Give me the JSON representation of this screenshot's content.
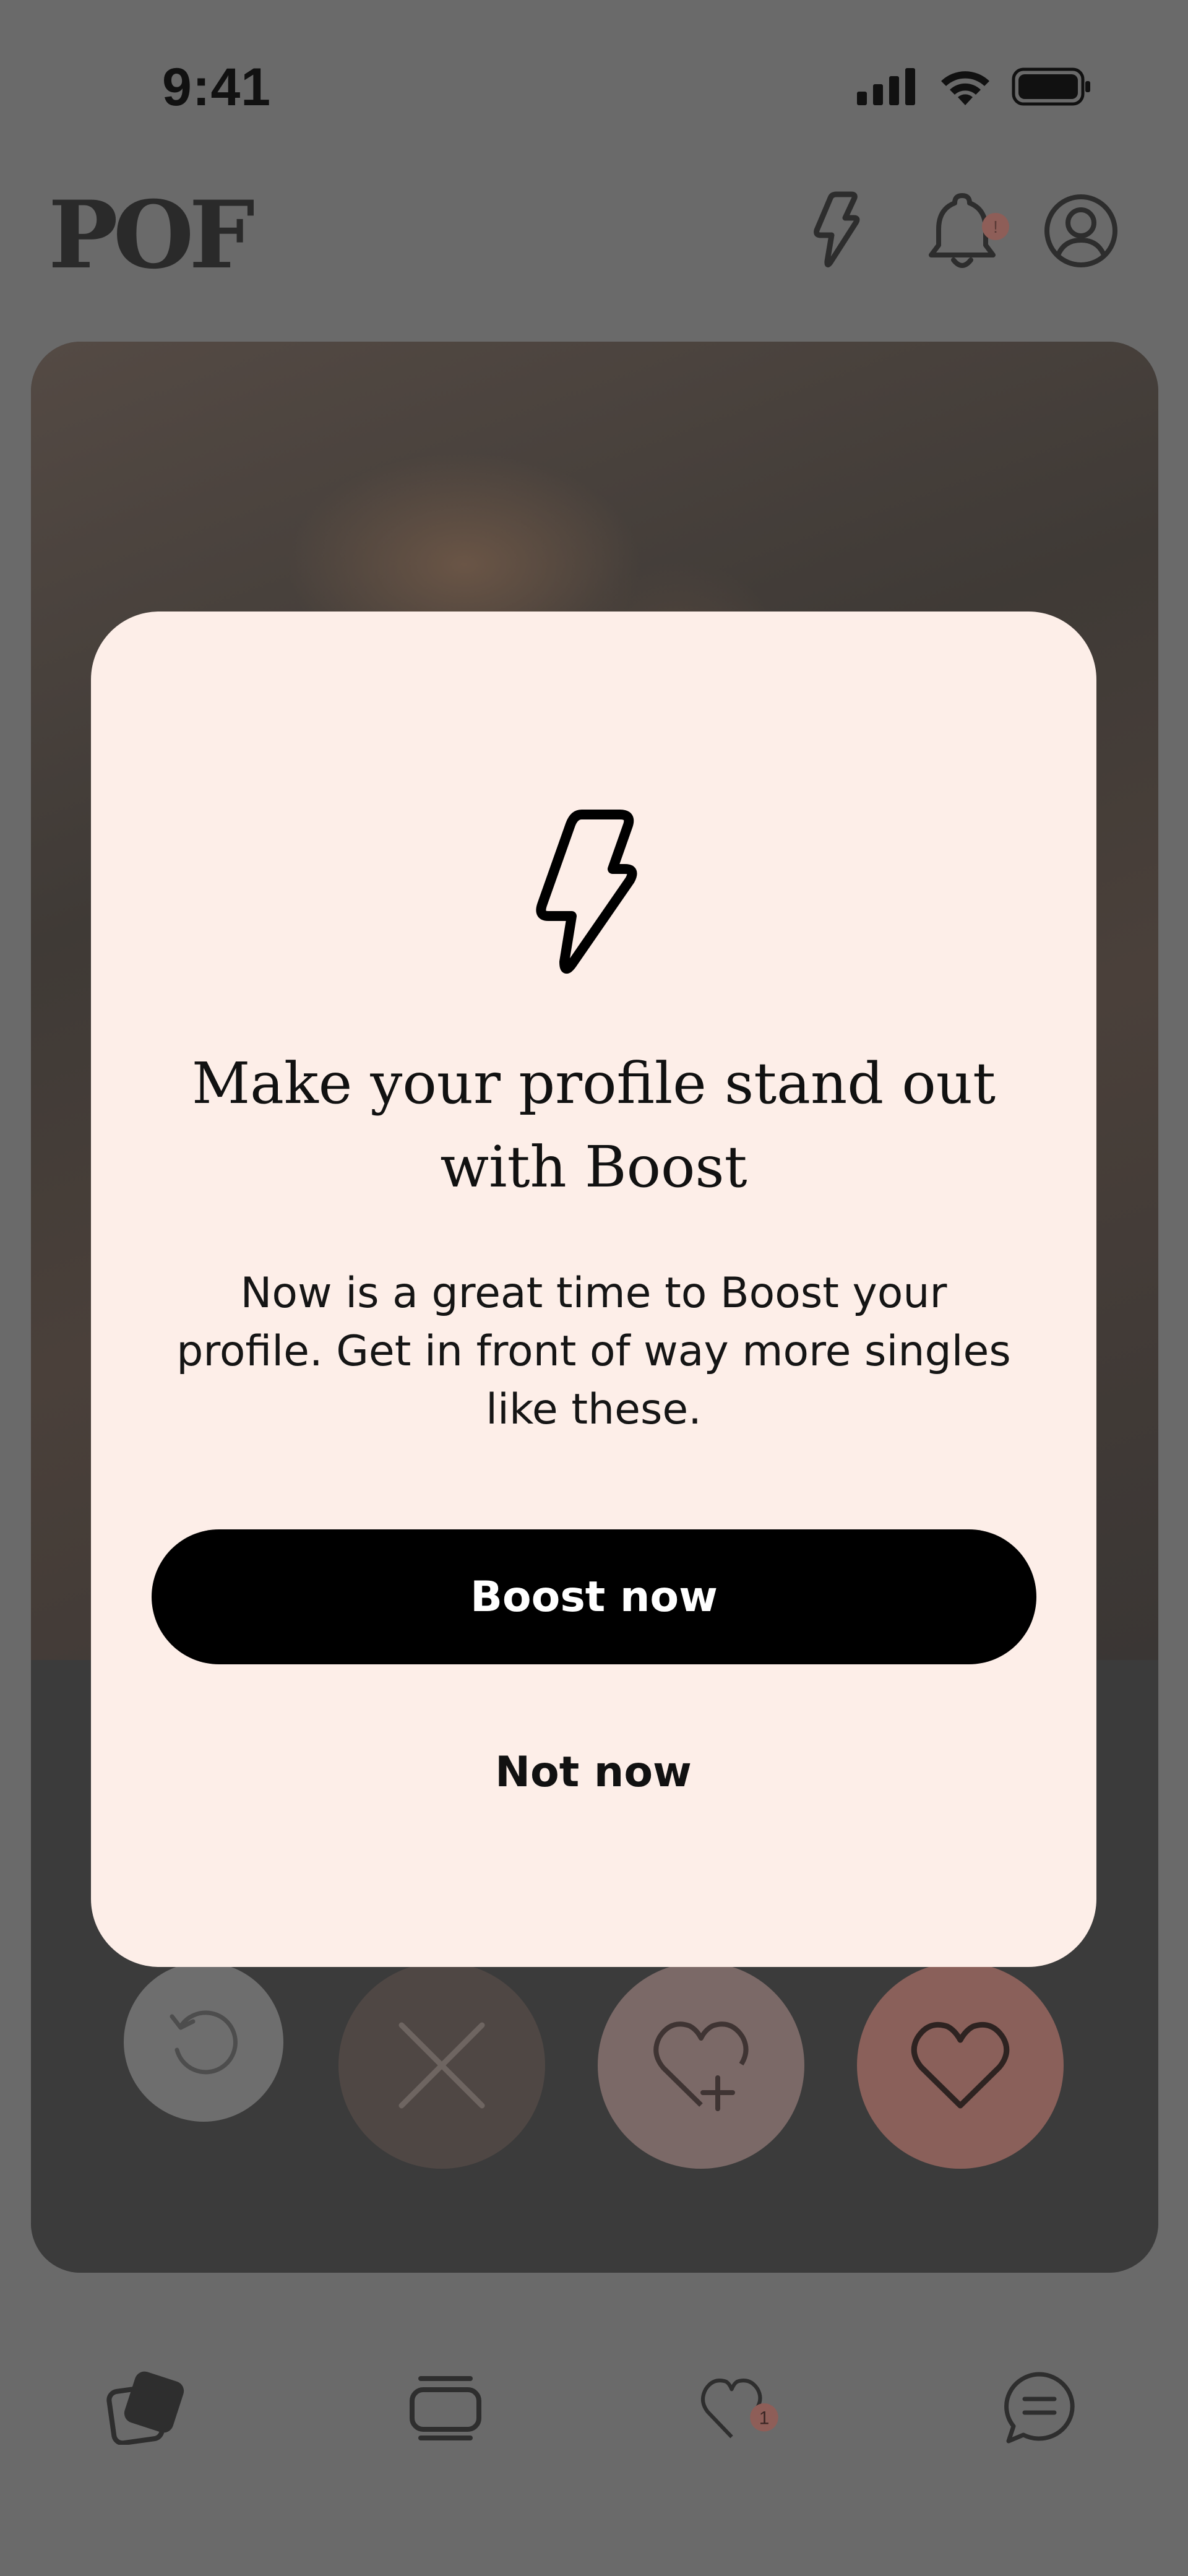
{
  "status_bar": {
    "time": "9:41",
    "icons": [
      "cellular-signal-icon",
      "wifi-icon",
      "battery-icon"
    ]
  },
  "header": {
    "logo": "POF",
    "icons": [
      "boost-lightning-icon",
      "notification-bell-icon",
      "profile-avatar-icon"
    ],
    "notification_badge": "!"
  },
  "card_actions": [
    "undo-icon",
    "pass-x-icon",
    "super-like-heart-plus-icon",
    "like-heart-icon"
  ],
  "bottom_nav": {
    "items": [
      "discover-cards-icon",
      "meet-me-icon",
      "likes-heart-icon",
      "messages-icon"
    ],
    "likes_badge": "1"
  },
  "modal": {
    "icon": "lightning-bolt-icon",
    "title_line1": "Make your profile stand out",
    "title_line2": "with Boost",
    "body_line1": "Now is a great time to Boost your",
    "body_line2": "profile. Get in front of way more singles",
    "body_line3": "like these.",
    "primary_button": "Boost now",
    "secondary_button": "Not now"
  },
  "colors": {
    "overlay": "#6a6a6a",
    "modal_bg": "#fdeee8",
    "primary_button_bg": "#000000",
    "like_button": "#8a605a",
    "super_like_button": "#7b6967",
    "pass_button": "#4f4744",
    "undo_button": "#6e6e6e"
  }
}
